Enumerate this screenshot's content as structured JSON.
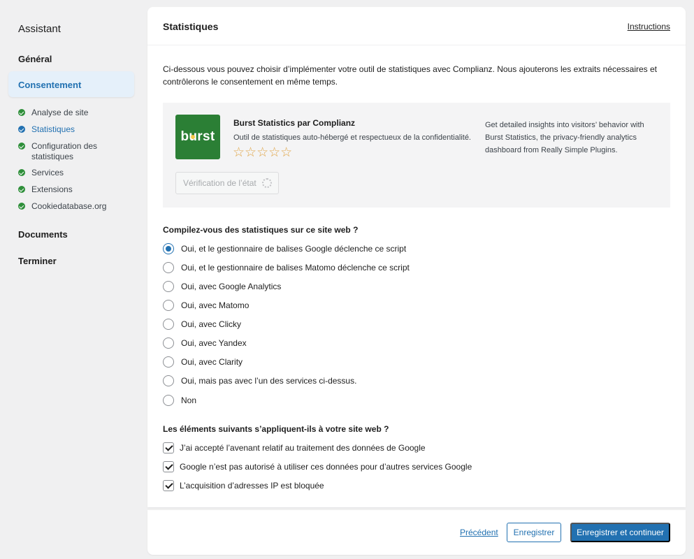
{
  "sidebar": {
    "title": "Assistant",
    "sections": {
      "general": "Général",
      "consent": "Consentement",
      "documents": "Documents",
      "finish": "Terminer"
    },
    "sub_items": [
      {
        "label": "Analyse de site",
        "status": "done"
      },
      {
        "label": "Statistiques",
        "status": "current"
      },
      {
        "label": "Configuration des statistiques",
        "status": "done"
      },
      {
        "label": "Services",
        "status": "done"
      },
      {
        "label": "Extensions",
        "status": "done"
      },
      {
        "label": "Cookiedatabase.org",
        "status": "done"
      }
    ]
  },
  "main": {
    "title": "Statistiques",
    "instructions_link": "Instructions",
    "intro": "Ci-dessous vous pouvez choisir d’implémenter votre outil de statistiques avec Complianz. Nous ajouterons les extraits nécessaires et contrôlerons le consentement en même temps.",
    "promo": {
      "logo_text_b": "b",
      "logo_text_u": "u",
      "logo_text_rest": "rst",
      "name": "Burst Statistics par Complianz",
      "description": "Outil de statistiques auto-hébergé et respectueux de la confidentialité.",
      "stars": "☆☆☆☆☆",
      "right_text": "Get detailed insights into visitors’ behavior with Burst Statistics, the privacy-friendly analytics dashboard from Really Simple Plugins.",
      "verify_button": "Vérification de l’état"
    },
    "question1": {
      "label": "Compilez-vous des statistiques sur ce site web ?",
      "selected_index": 0,
      "options": [
        "Oui, et le gestionnaire de balises Google déclenche ce script",
        "Oui, et le gestionnaire de balises Matomo déclenche ce script",
        "Oui, avec Google Analytics",
        "Oui, avec Matomo",
        "Oui, avec Clicky",
        "Oui, avec Yandex",
        "Oui, avec Clarity",
        "Oui, mais pas avec l’un des services ci-dessus.",
        "Non"
      ]
    },
    "question2": {
      "label": "Les éléments suivants s’appliquent-ils à votre site web ?",
      "options": [
        {
          "label": "J’ai accepté l’avenant relatif au traitement des données de Google",
          "checked": true
        },
        {
          "label": "Google n’est pas autorisé à utiliser ces données pour d’autres services Google",
          "checked": true
        },
        {
          "label": "L’acquisition d’adresses IP est bloquée",
          "checked": true
        }
      ]
    }
  },
  "footer": {
    "previous": "Précédent",
    "save": "Enregistrer",
    "save_continue": "Enregistrer et continuer"
  },
  "colors": {
    "accent": "#2271b1",
    "success": "#2e8f3a",
    "burst_green": "#2b7f35",
    "star": "#e0a64a"
  }
}
